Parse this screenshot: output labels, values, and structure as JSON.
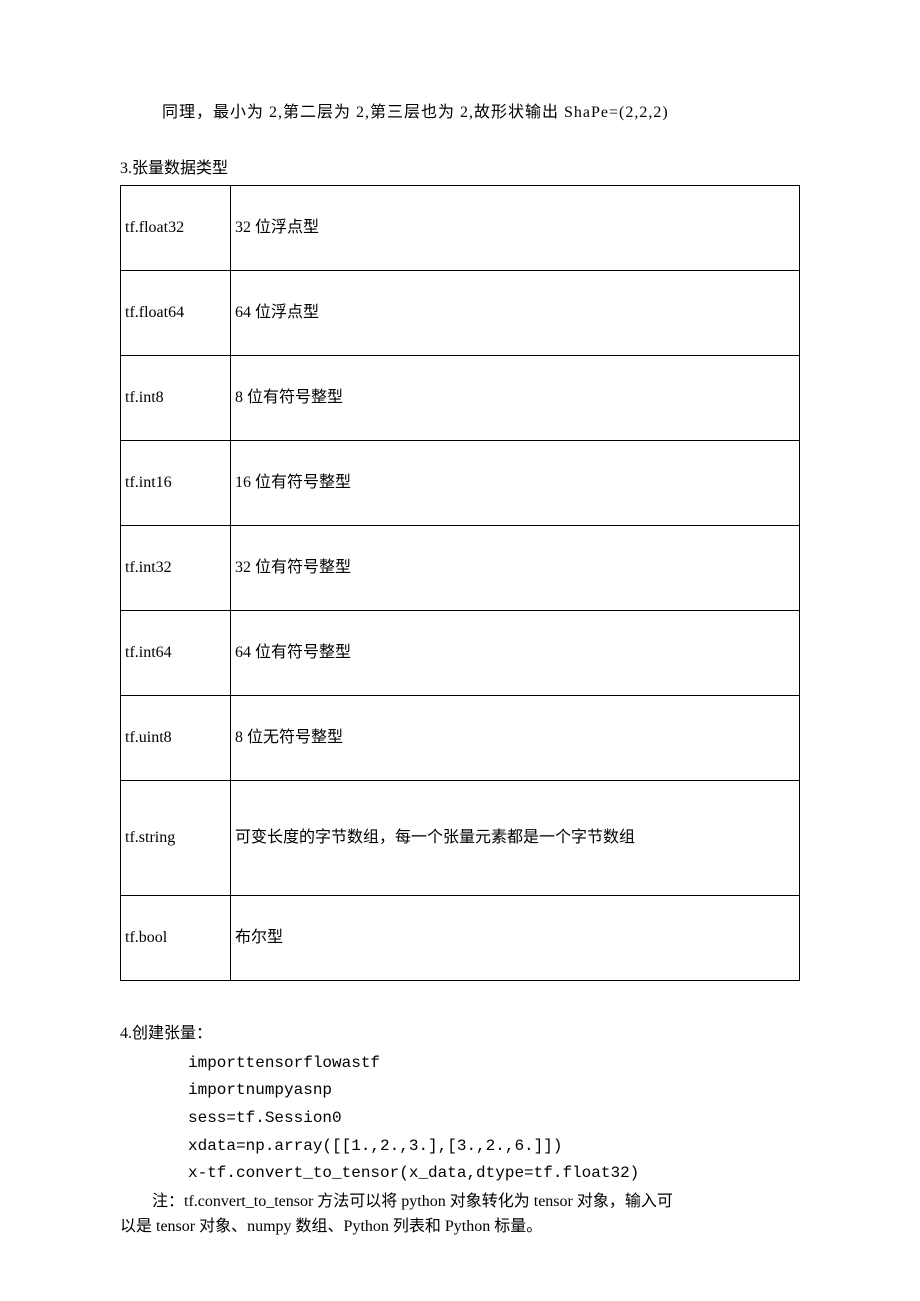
{
  "intro": "同理，最小为 2,第二层为 2,第三层也为 2,故形状输出 ShaPe=(2,2,2)",
  "section3_title": "3.张量数据类型",
  "table_rows": [
    {
      "type": "tf.float32",
      "desc": "32 位浮点型"
    },
    {
      "type": "tf.float64",
      "desc": "64 位浮点型"
    },
    {
      "type": "tf.int8",
      "desc": "8 位有符号整型"
    },
    {
      "type": "tf.int16",
      "desc": "16 位有符号整型"
    },
    {
      "type": "tf.int32",
      "desc": "32 位有符号整型"
    },
    {
      "type": "tf.int64",
      "desc": "64 位有符号整型"
    },
    {
      "type": "tf.uint8",
      "desc": "8 位无符号整型"
    },
    {
      "type": "tf.string",
      "desc": "可变长度的字节数组，每一个张量元素都是一个字节数组"
    },
    {
      "type": "tf.bool",
      "desc": "布尔型"
    }
  ],
  "section4_title": "4.创建张量：",
  "code": {
    "l1": "importtensorflowastf",
    "l2": "importnumpyasnp",
    "l3": "sess=tf.Session0",
    "l4": "xdata=np.array([[1.,2.,3.],[3.,2.,6.]])",
    "l5": "x-tf.convert_to_tensor(x_data,dtype=tf.float32)"
  },
  "note1": "注：tf.convert_to_tensor 方法可以将 python 对象转化为 tensor 对象，输入可",
  "note2": "以是 tensor 对象、numpy 数组、Python 列表和 Python 标量。"
}
